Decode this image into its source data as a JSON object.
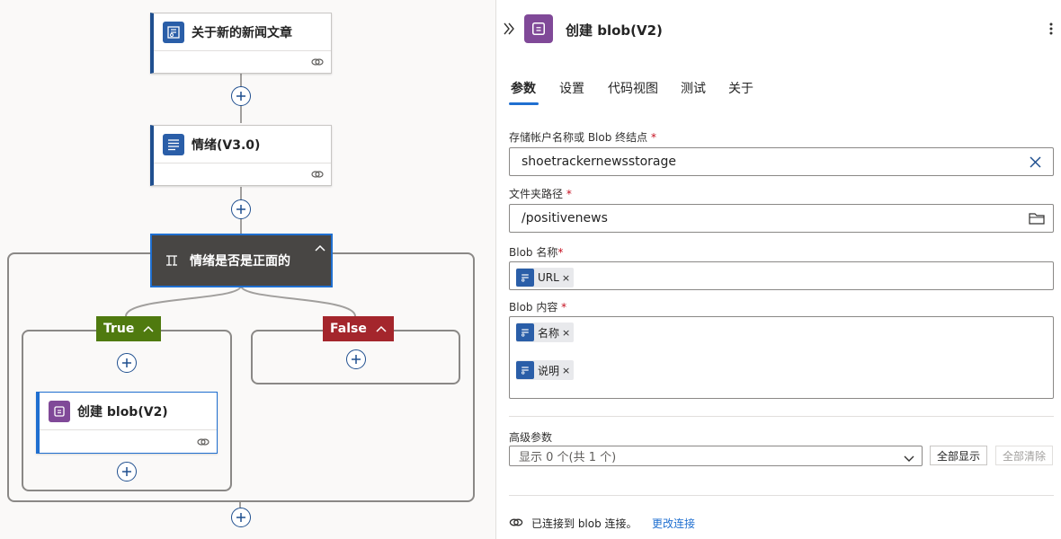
{
  "canvas": {
    "nodes": {
      "trigger": {
        "title": "关于新的新闻文章"
      },
      "sentiment": {
        "title": "情绪(V3.0)"
      },
      "condition": {
        "title": "情绪是否是正面的"
      },
      "true_branch": {
        "label": "True"
      },
      "false_branch": {
        "label": "False"
      },
      "create_blob": {
        "title": "创建 blob(V2)"
      }
    },
    "colors": {
      "true": "#4f7a0f",
      "false": "#a4262c",
      "accent": "#1f4f8f",
      "blob": "#804998"
    }
  },
  "panel": {
    "title": "创建 blob(V2)",
    "tabs": [
      "参数",
      "设置",
      "代码视图",
      "测试",
      "关于"
    ],
    "active_tab": "参数",
    "fields": {
      "storage": {
        "label": "存储帐户名称或 Blob 终结点",
        "value": "shoetrackernewsstorage"
      },
      "folder": {
        "label": "文件夹路径",
        "value": "/positivenews"
      },
      "blob_name": {
        "label": "Blob 名称",
        "tokens": [
          "URL"
        ]
      },
      "blob_content": {
        "label": "Blob 内容",
        "tokens": [
          "名称",
          "说明"
        ]
      }
    },
    "required_mark": "*",
    "advanced": {
      "label": "高级参数",
      "select_value": "显示 0 个(共 1 个)",
      "show_all": "全部显示",
      "clear_all": "全部清除"
    },
    "connection": {
      "text": "已连接到 blob 连接。",
      "change_link": "更改连接"
    }
  }
}
